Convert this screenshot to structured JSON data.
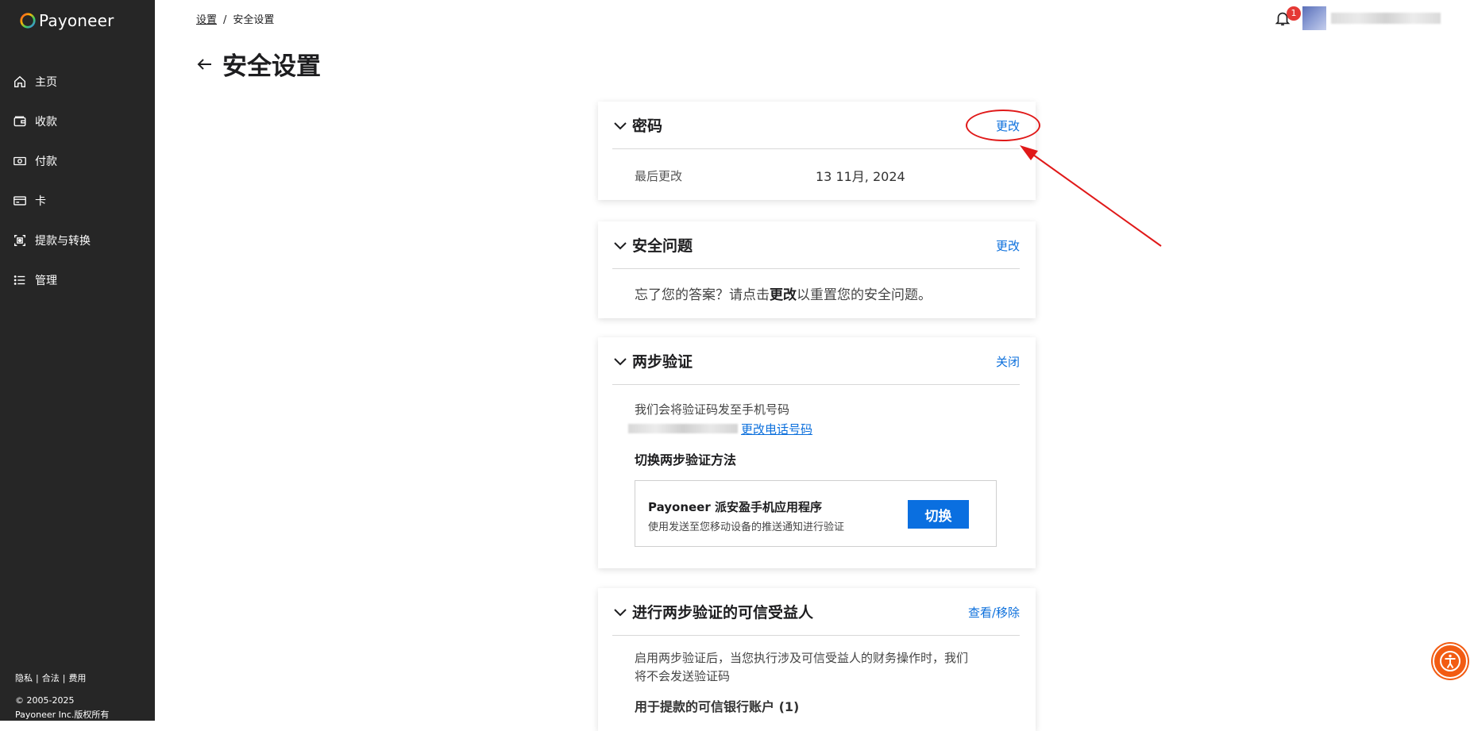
{
  "brand": {
    "name": "Payoneer"
  },
  "sidebar": {
    "items": [
      {
        "label": "主页",
        "icon": "home-icon"
      },
      {
        "label": "收款",
        "icon": "wallet-icon"
      },
      {
        "label": "付款",
        "icon": "cash-icon"
      },
      {
        "label": "卡",
        "icon": "card-icon"
      },
      {
        "label": "提款与转换",
        "icon": "withdraw-icon"
      },
      {
        "label": "管理",
        "icon": "list-icon"
      }
    ],
    "footer": {
      "links": [
        "隐私",
        "合法",
        "费用"
      ],
      "copyright": "© 2005-2025",
      "company": "Payoneer Inc.版权所有"
    }
  },
  "breadcrumb": {
    "parent": "设置",
    "current": "安全设置"
  },
  "page": {
    "title": "安全设置"
  },
  "header": {
    "notification_count": "1"
  },
  "cards": {
    "password": {
      "title": "密码",
      "action": "更改",
      "last_changed_label": "最后更改",
      "last_changed_value": "13 11月, 2024"
    },
    "security_question": {
      "title": "安全问题",
      "action": "更改",
      "text_before": "忘了您的答案？请点击",
      "text_bold": "更改",
      "text_after": "以重置您的安全问题。"
    },
    "two_step": {
      "title": "两步验证",
      "action": "关闭",
      "send_text": "我们会将验证码发至手机号码",
      "change_phone": "更改电话号码",
      "switch_heading": "切换两步验证方法",
      "method_title": "Payoneer 派安盈手机应用程序",
      "method_sub": "使用发送至您移动设备的推送通知进行验证",
      "switch_button": "切换"
    },
    "trusted": {
      "title": "进行两步验证的可信受益人",
      "action": "查看/移除",
      "desc_line1": "启用两步验证后，当您执行涉及可信受益人的财务操作时，我们",
      "desc_line2": "将不会发送验证码",
      "bank_heading": "用于提款的可信银行账户 (1)"
    }
  },
  "colors": {
    "sidebar_bg": "#262626",
    "link": "#0b6fdc",
    "primary_button": "#0a6fe0",
    "annotation": "#e01919",
    "accessibility": "#f25c13"
  }
}
